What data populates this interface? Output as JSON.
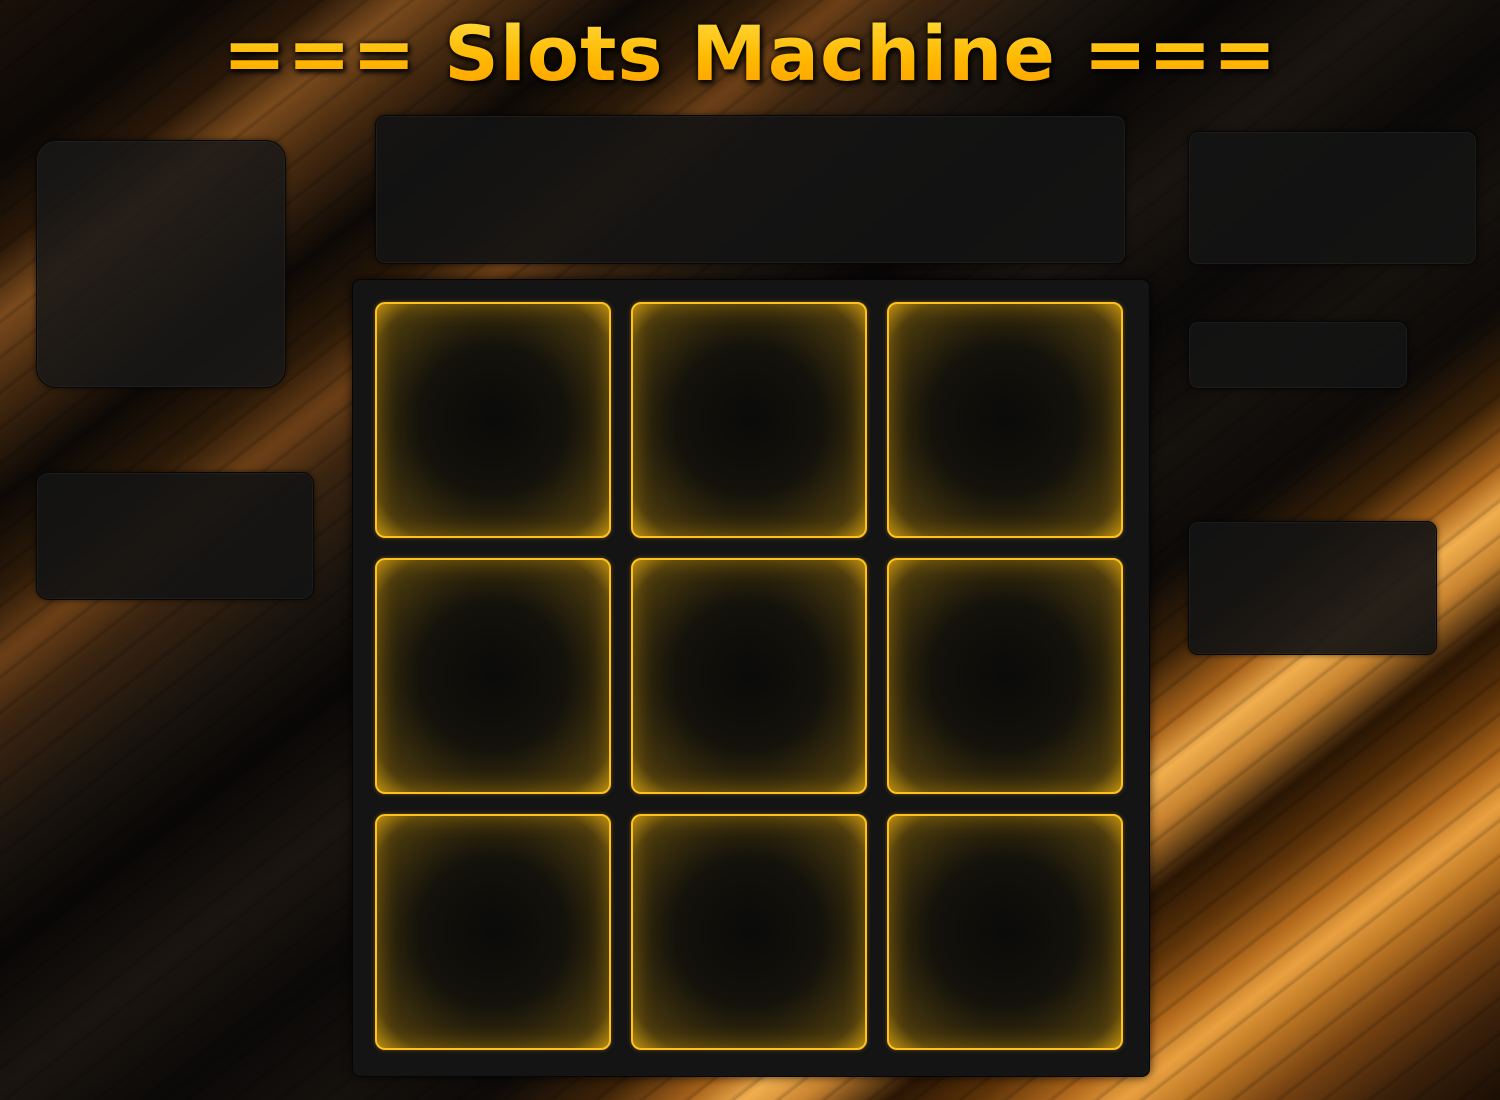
{
  "title": "=== Slots Machine ===",
  "colors": {
    "accent": "#ffc020",
    "panel": "#141414",
    "background": "#0a0806"
  },
  "reels": [
    {
      "symbol": ""
    },
    {
      "symbol": ""
    },
    {
      "symbol": ""
    },
    {
      "symbol": ""
    },
    {
      "symbol": ""
    },
    {
      "symbol": ""
    },
    {
      "symbol": ""
    },
    {
      "symbol": ""
    },
    {
      "symbol": ""
    }
  ]
}
